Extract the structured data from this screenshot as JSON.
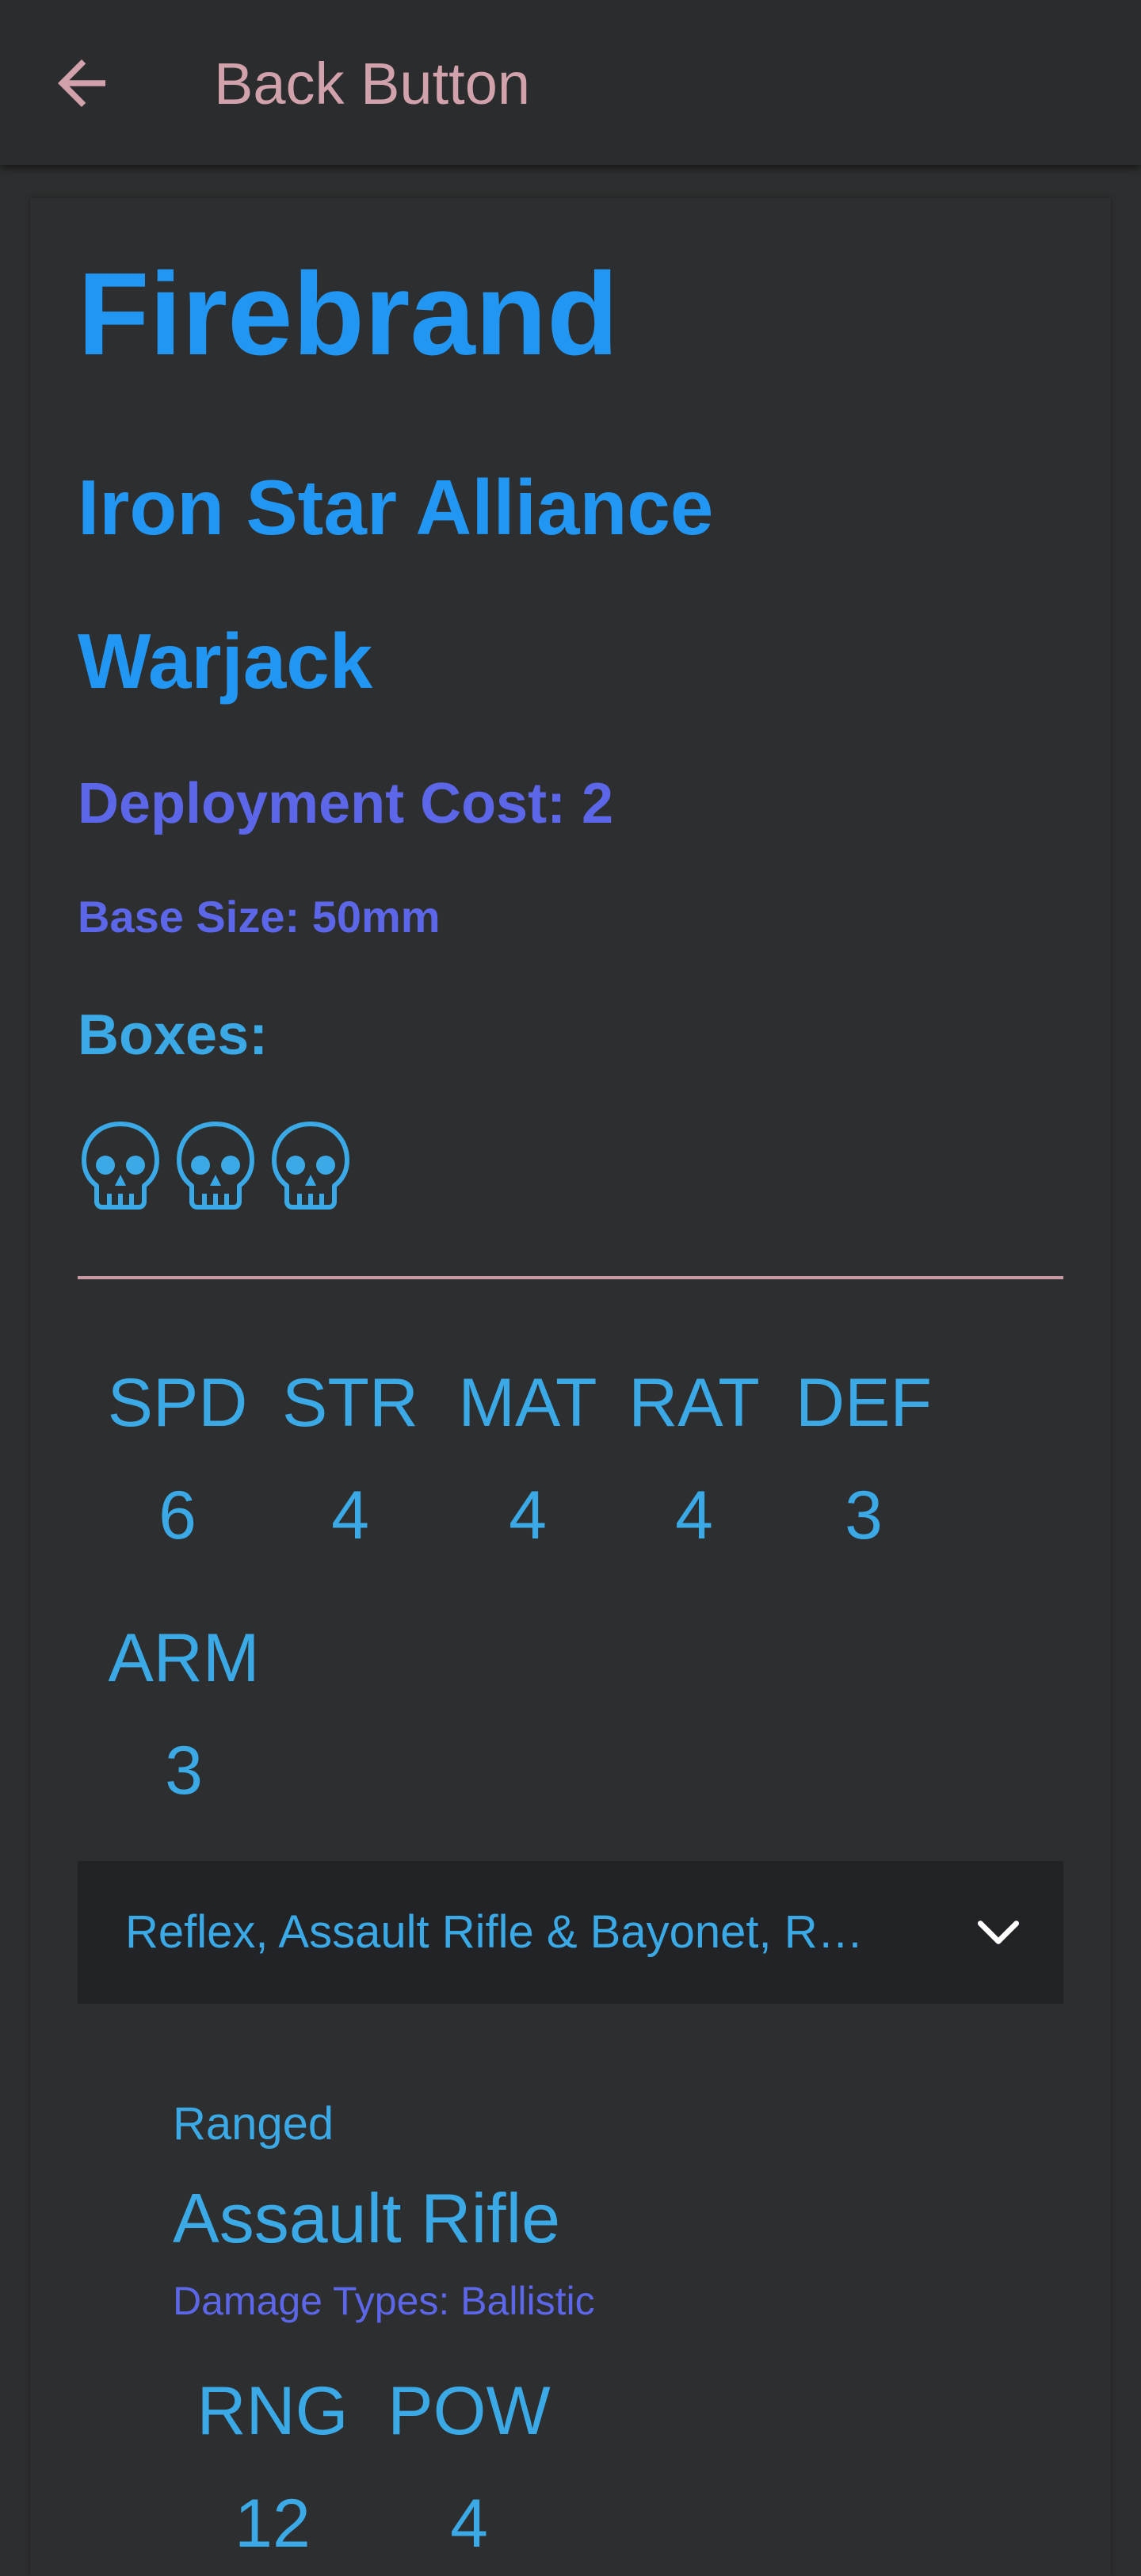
{
  "app_bar": {
    "title": "Back Button",
    "back_icon": "arrow-left-icon",
    "title_color": "#d1a2ab"
  },
  "model": {
    "name": "Firebrand",
    "faction": "Iron Star Alliance",
    "type": "Warjack",
    "deployment_cost": "Deployment Cost: 2",
    "base_size": "Base Size: 50mm",
    "boxes_label": "Boxes:",
    "boxes_icons": [
      "skull-icon",
      "skull-icon",
      "skull-icon"
    ]
  },
  "stats": [
    {
      "label": "SPD",
      "value": "6"
    },
    {
      "label": "STR",
      "value": "4"
    },
    {
      "label": "MAT",
      "value": "4"
    },
    {
      "label": "RAT",
      "value": "4"
    },
    {
      "label": "DEF",
      "value": "3"
    },
    {
      "label": "ARM",
      "value": "3"
    }
  ],
  "abilities_dropdown": {
    "text": "Reflex, Assault Rifle & Bayonet, R…",
    "icon": "chevron-down-icon"
  },
  "weapon": {
    "category": "Ranged",
    "name": "Assault Rifle",
    "damage_types": "Damage Types: Ballistic",
    "stats": [
      {
        "label": "RNG",
        "value": "12"
      },
      {
        "label": "POW",
        "value": "4"
      }
    ]
  },
  "colors": {
    "primary_blue": "#2196f3",
    "indigo": "#5c66e8",
    "sky": "#3aa9e6",
    "divider_pink": "#c79aa3",
    "background": "#2d2e2f"
  }
}
